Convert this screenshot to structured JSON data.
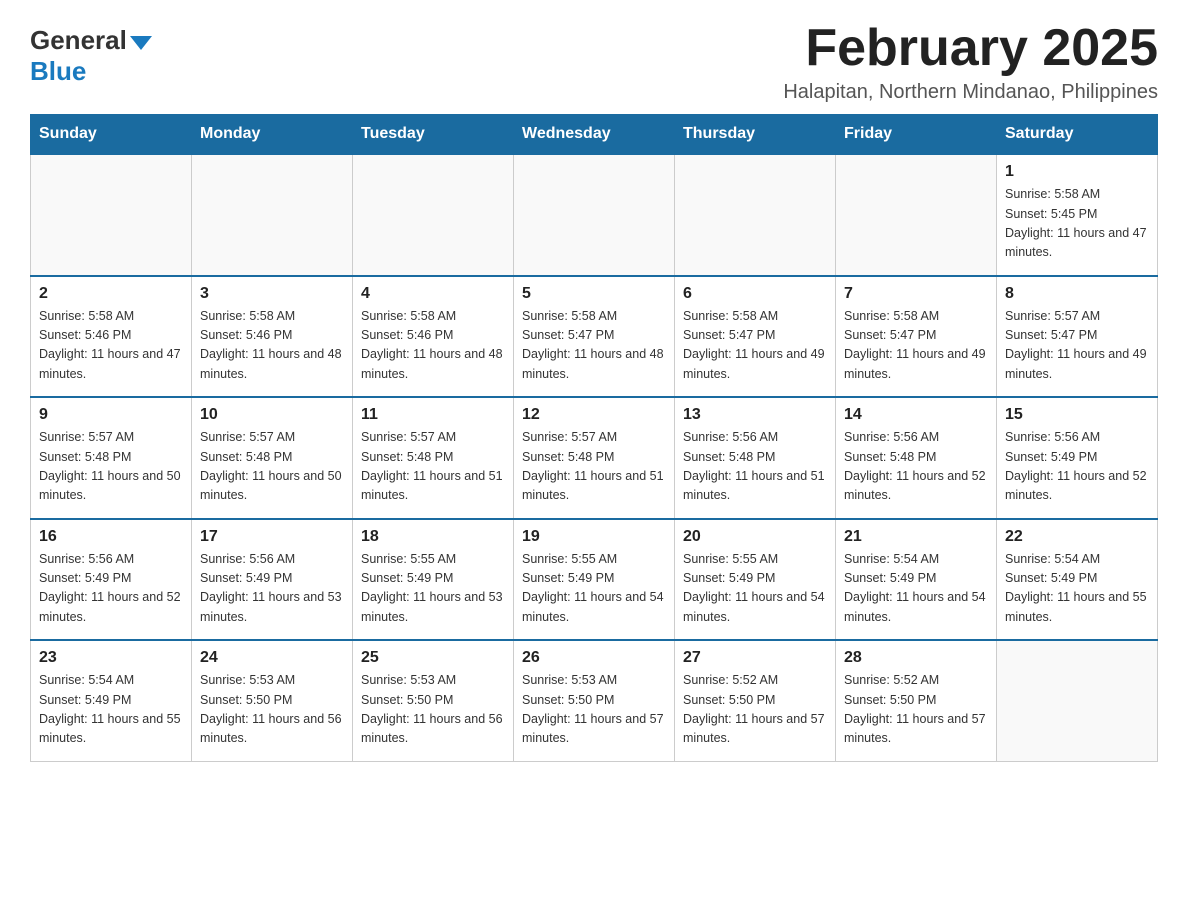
{
  "logo": {
    "general": "General",
    "blue": "Blue"
  },
  "header": {
    "month_year": "February 2025",
    "location": "Halapitan, Northern Mindanao, Philippines"
  },
  "weekdays": [
    "Sunday",
    "Monday",
    "Tuesday",
    "Wednesday",
    "Thursday",
    "Friday",
    "Saturday"
  ],
  "weeks": [
    [
      {
        "day": "",
        "info": ""
      },
      {
        "day": "",
        "info": ""
      },
      {
        "day": "",
        "info": ""
      },
      {
        "day": "",
        "info": ""
      },
      {
        "day": "",
        "info": ""
      },
      {
        "day": "",
        "info": ""
      },
      {
        "day": "1",
        "info": "Sunrise: 5:58 AM\nSunset: 5:45 PM\nDaylight: 11 hours and 47 minutes."
      }
    ],
    [
      {
        "day": "2",
        "info": "Sunrise: 5:58 AM\nSunset: 5:46 PM\nDaylight: 11 hours and 47 minutes."
      },
      {
        "day": "3",
        "info": "Sunrise: 5:58 AM\nSunset: 5:46 PM\nDaylight: 11 hours and 48 minutes."
      },
      {
        "day": "4",
        "info": "Sunrise: 5:58 AM\nSunset: 5:46 PM\nDaylight: 11 hours and 48 minutes."
      },
      {
        "day": "5",
        "info": "Sunrise: 5:58 AM\nSunset: 5:47 PM\nDaylight: 11 hours and 48 minutes."
      },
      {
        "day": "6",
        "info": "Sunrise: 5:58 AM\nSunset: 5:47 PM\nDaylight: 11 hours and 49 minutes."
      },
      {
        "day": "7",
        "info": "Sunrise: 5:58 AM\nSunset: 5:47 PM\nDaylight: 11 hours and 49 minutes."
      },
      {
        "day": "8",
        "info": "Sunrise: 5:57 AM\nSunset: 5:47 PM\nDaylight: 11 hours and 49 minutes."
      }
    ],
    [
      {
        "day": "9",
        "info": "Sunrise: 5:57 AM\nSunset: 5:48 PM\nDaylight: 11 hours and 50 minutes."
      },
      {
        "day": "10",
        "info": "Sunrise: 5:57 AM\nSunset: 5:48 PM\nDaylight: 11 hours and 50 minutes."
      },
      {
        "day": "11",
        "info": "Sunrise: 5:57 AM\nSunset: 5:48 PM\nDaylight: 11 hours and 51 minutes."
      },
      {
        "day": "12",
        "info": "Sunrise: 5:57 AM\nSunset: 5:48 PM\nDaylight: 11 hours and 51 minutes."
      },
      {
        "day": "13",
        "info": "Sunrise: 5:56 AM\nSunset: 5:48 PM\nDaylight: 11 hours and 51 minutes."
      },
      {
        "day": "14",
        "info": "Sunrise: 5:56 AM\nSunset: 5:48 PM\nDaylight: 11 hours and 52 minutes."
      },
      {
        "day": "15",
        "info": "Sunrise: 5:56 AM\nSunset: 5:49 PM\nDaylight: 11 hours and 52 minutes."
      }
    ],
    [
      {
        "day": "16",
        "info": "Sunrise: 5:56 AM\nSunset: 5:49 PM\nDaylight: 11 hours and 52 minutes."
      },
      {
        "day": "17",
        "info": "Sunrise: 5:56 AM\nSunset: 5:49 PM\nDaylight: 11 hours and 53 minutes."
      },
      {
        "day": "18",
        "info": "Sunrise: 5:55 AM\nSunset: 5:49 PM\nDaylight: 11 hours and 53 minutes."
      },
      {
        "day": "19",
        "info": "Sunrise: 5:55 AM\nSunset: 5:49 PM\nDaylight: 11 hours and 54 minutes."
      },
      {
        "day": "20",
        "info": "Sunrise: 5:55 AM\nSunset: 5:49 PM\nDaylight: 11 hours and 54 minutes."
      },
      {
        "day": "21",
        "info": "Sunrise: 5:54 AM\nSunset: 5:49 PM\nDaylight: 11 hours and 54 minutes."
      },
      {
        "day": "22",
        "info": "Sunrise: 5:54 AM\nSunset: 5:49 PM\nDaylight: 11 hours and 55 minutes."
      }
    ],
    [
      {
        "day": "23",
        "info": "Sunrise: 5:54 AM\nSunset: 5:49 PM\nDaylight: 11 hours and 55 minutes."
      },
      {
        "day": "24",
        "info": "Sunrise: 5:53 AM\nSunset: 5:50 PM\nDaylight: 11 hours and 56 minutes."
      },
      {
        "day": "25",
        "info": "Sunrise: 5:53 AM\nSunset: 5:50 PM\nDaylight: 11 hours and 56 minutes."
      },
      {
        "day": "26",
        "info": "Sunrise: 5:53 AM\nSunset: 5:50 PM\nDaylight: 11 hours and 57 minutes."
      },
      {
        "day": "27",
        "info": "Sunrise: 5:52 AM\nSunset: 5:50 PM\nDaylight: 11 hours and 57 minutes."
      },
      {
        "day": "28",
        "info": "Sunrise: 5:52 AM\nSunset: 5:50 PM\nDaylight: 11 hours and 57 minutes."
      },
      {
        "day": "",
        "info": ""
      }
    ]
  ]
}
